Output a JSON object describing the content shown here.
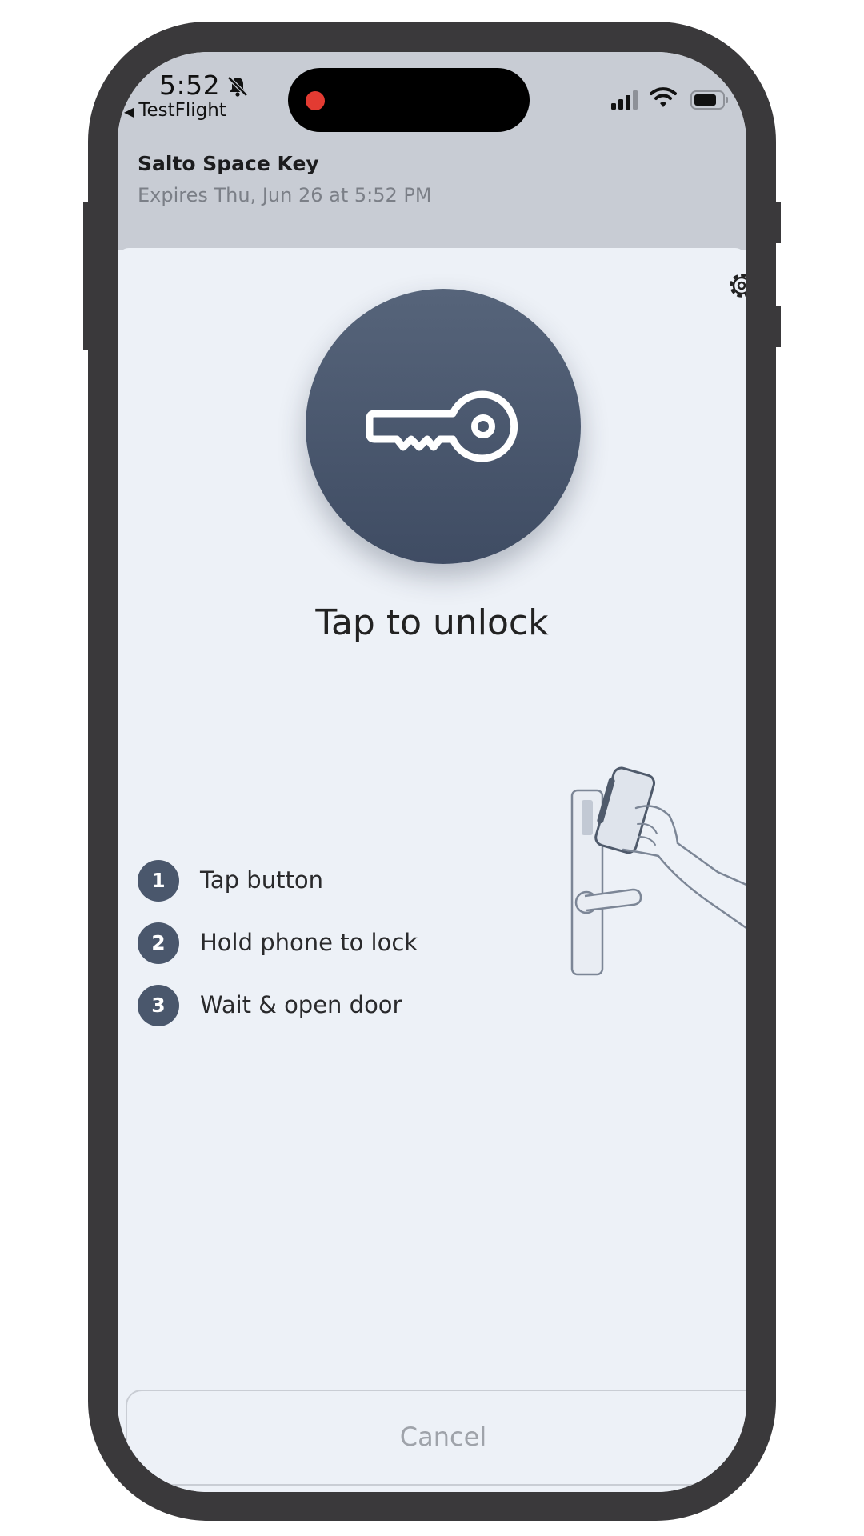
{
  "status_bar": {
    "time": "5:52",
    "back_app": "TestFlight",
    "icons": [
      "bell-slash-icon",
      "signal-icon",
      "wifi-icon",
      "battery-icon"
    ],
    "recording_dot_color": "#e33b32"
  },
  "header": {
    "key_name": "Salto Space Key",
    "expiry": "Expires Thu, Jun 26 at 5:52 PM"
  },
  "main": {
    "settings_icon": "gear-icon",
    "unlock_icon": "key-icon",
    "unlock_label": "Tap to unlock",
    "steps": [
      {
        "number": "1",
        "label": "Tap button"
      },
      {
        "number": "2",
        "label": "Hold phone to lock"
      },
      {
        "number": "3",
        "label": "Wait & open door"
      }
    ],
    "illustration": "phone-to-lock-illustration"
  },
  "footer": {
    "cancel_label": "Cancel"
  },
  "colors": {
    "accent": "#4a576c",
    "sheet_background": "#edf1f7",
    "header_background": "#c8ccd4"
  }
}
